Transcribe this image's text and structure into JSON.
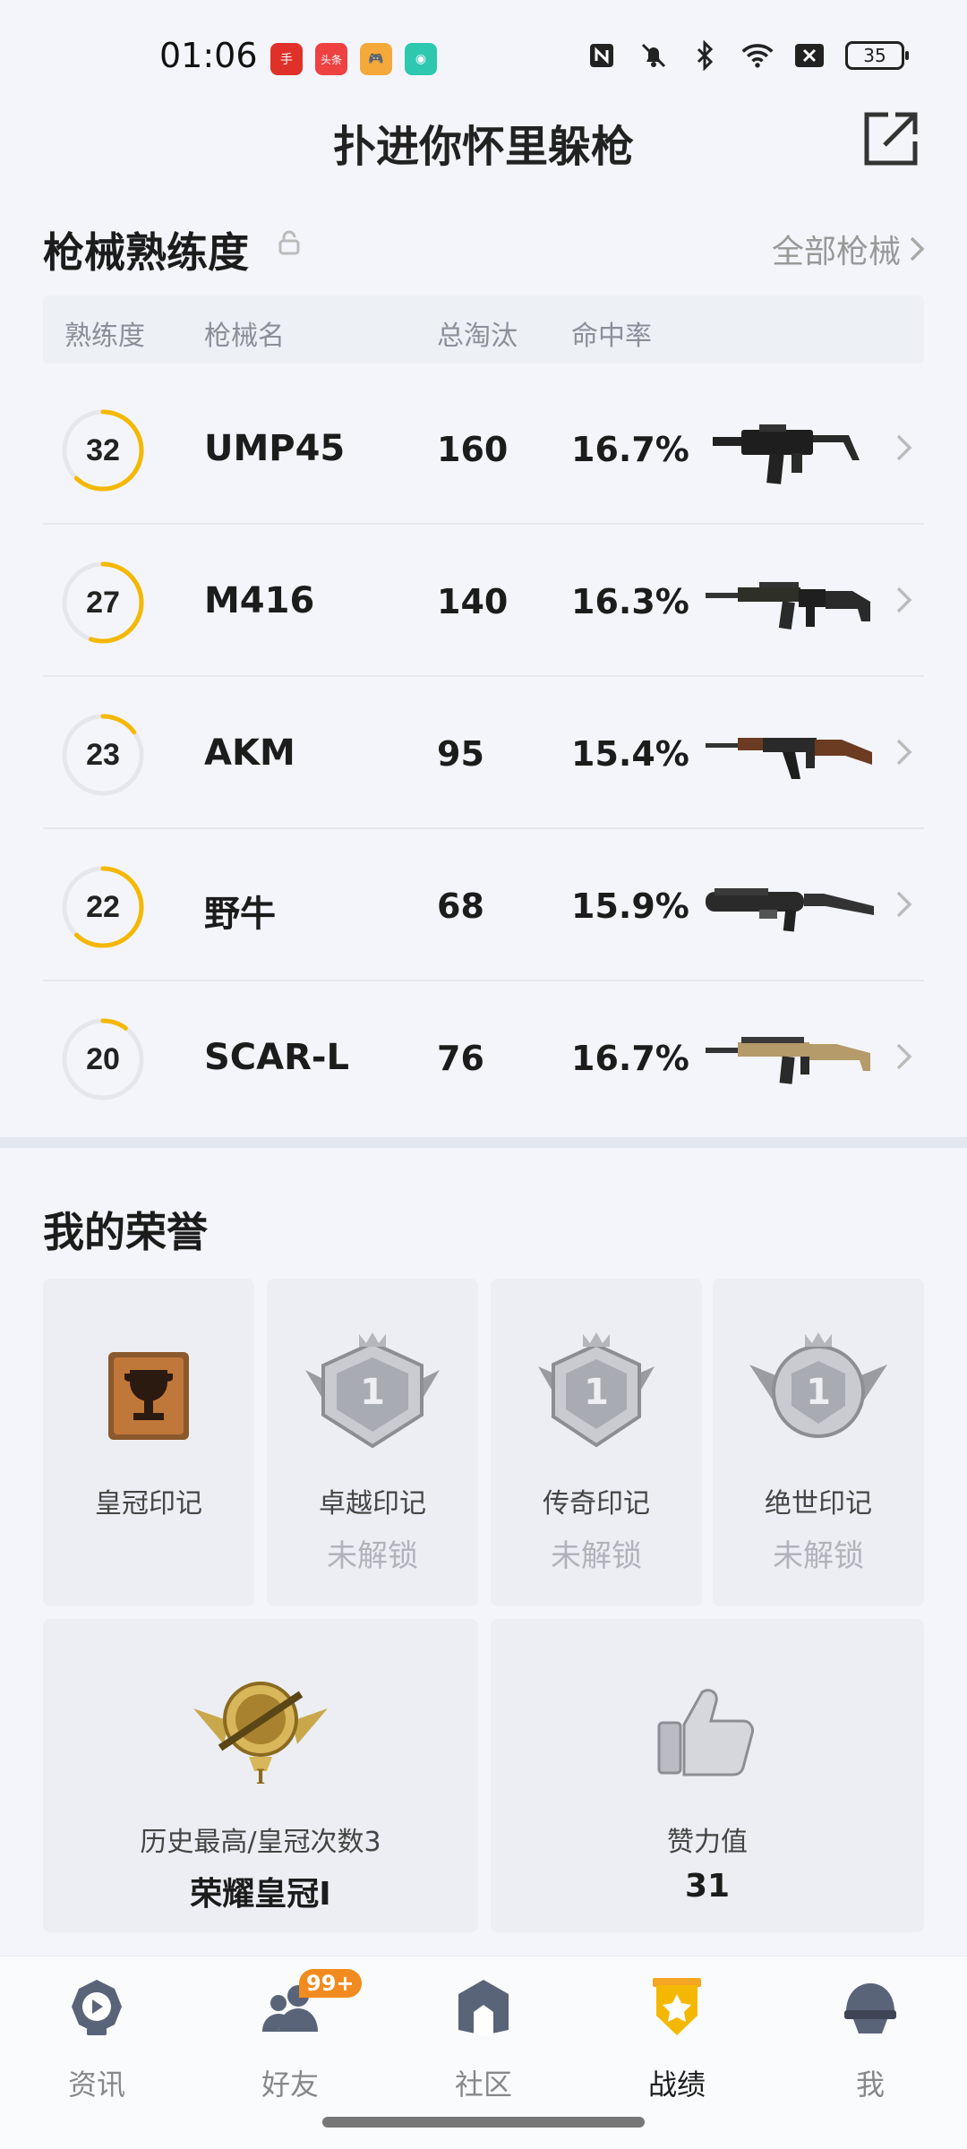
{
  "status_bar": {
    "time": "01:06",
    "app_icons": [
      {
        "name": "app1",
        "color": "#e0302a",
        "text": "手"
      },
      {
        "name": "toutiao",
        "color": "#f04142",
        "text": "头条"
      },
      {
        "name": "game",
        "color": "#f5a93a",
        "text": "🎮"
      },
      {
        "name": "chat",
        "color": "#2ec7b0",
        "text": "◉"
      }
    ],
    "battery": "35"
  },
  "header": {
    "title": "扑进你怀里躲枪"
  },
  "weapon_section": {
    "title": "枪械熟练度",
    "all_link": "全部枪械",
    "columns": [
      "熟练度",
      "枪械名",
      "总淘汰",
      "命中率"
    ],
    "rows": [
      {
        "level": "32",
        "progress": 0.62,
        "name": "UMP45",
        "kills": "160",
        "rate": "16.7%"
      },
      {
        "level": "27",
        "progress": 0.55,
        "name": "M416",
        "kills": "140",
        "rate": "16.3%"
      },
      {
        "level": "23",
        "progress": 0.15,
        "name": "AKM",
        "kills": "95",
        "rate": "15.4%"
      },
      {
        "level": "22",
        "progress": 0.62,
        "name": "野牛",
        "kills": "68",
        "rate": "15.9%"
      },
      {
        "level": "20",
        "progress": 0.1,
        "name": "SCAR-L",
        "kills": "76",
        "rate": "16.7%"
      }
    ]
  },
  "honor_section": {
    "title": "我的荣誉",
    "badges": [
      {
        "label": "皇冠印记",
        "sub": ""
      },
      {
        "label": "卓越印记",
        "sub": "未解锁"
      },
      {
        "label": "传奇印记",
        "sub": "未解锁"
      },
      {
        "label": "绝世印记",
        "sub": "未解锁"
      }
    ],
    "rank": {
      "label": "历史最高/皇冠次数3",
      "value": "荣耀皇冠I"
    },
    "likes": {
      "label": "赞力值",
      "value": "31"
    }
  },
  "bottom_nav": {
    "items": [
      {
        "label": "资讯",
        "active": false
      },
      {
        "label": "好友",
        "active": false,
        "badge": "99+"
      },
      {
        "label": "社区",
        "active": false
      },
      {
        "label": "战绩",
        "active": true
      },
      {
        "label": "我",
        "active": false
      }
    ]
  },
  "colors": {
    "accent": "#f5b800",
    "ring_bg": "#e5e7ec"
  }
}
